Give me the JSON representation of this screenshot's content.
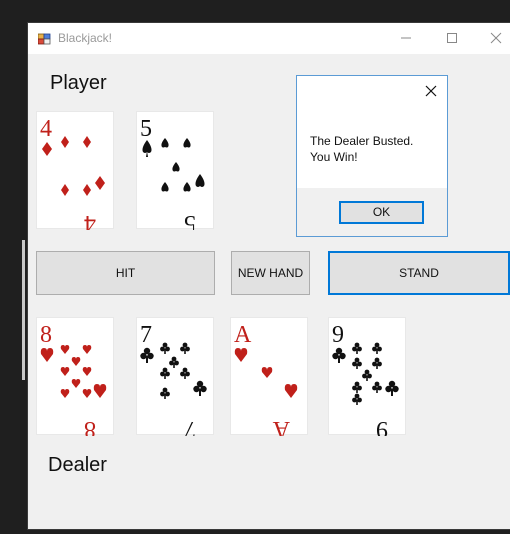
{
  "window": {
    "title": "Blackjack!",
    "controls": [
      "minimize",
      "maximize",
      "close"
    ]
  },
  "player": {
    "label": "Player",
    "cards": [
      {
        "rank": "4",
        "suit": "diamonds",
        "color": "#c0201a"
      },
      {
        "rank": "5",
        "suit": "spades",
        "color": "#111111"
      }
    ]
  },
  "dealer": {
    "label": "Dealer",
    "cards": [
      {
        "rank": "8",
        "suit": "hearts",
        "color": "#c0201a"
      },
      {
        "rank": "7",
        "suit": "clubs",
        "color": "#111111"
      },
      {
        "rank": "A",
        "suit": "hearts",
        "color": "#c0201a"
      },
      {
        "rank": "9",
        "suit": "clubs",
        "color": "#111111"
      }
    ]
  },
  "buttons": {
    "hit": "HIT",
    "new_hand": "NEW HAND",
    "stand": "STAND"
  },
  "dialog": {
    "message_line1": "The Dealer Busted.",
    "message_line2": "You Win!",
    "ok": "OK"
  },
  "colors": {
    "accent": "#0078d7",
    "red_suit": "#c0201a",
    "black_suit": "#111111"
  }
}
